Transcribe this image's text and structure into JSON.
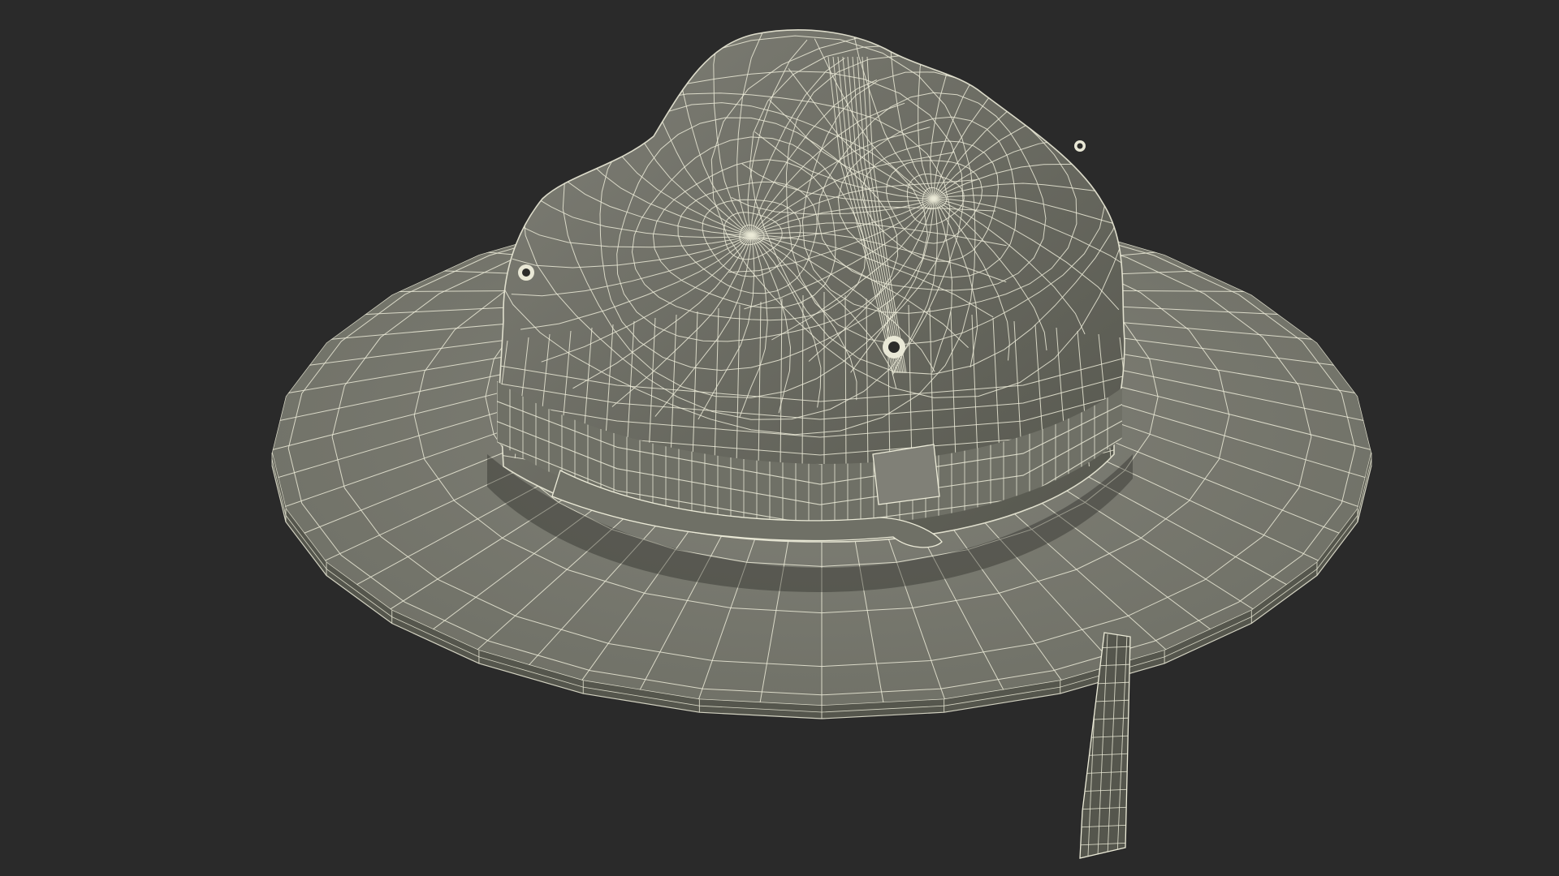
{
  "scene": {
    "subject": "campaign-hat-wireframe",
    "render_mode": "wireframe-over-shaded",
    "colors": {
      "background": "#2a2a2a",
      "surface_light": "#808077",
      "surface": "#6f7066",
      "surface_dark": "#55564d",
      "shadow": "#1d1d1b",
      "wire": "#ecebd8",
      "wire_soft": "#d8d7c4",
      "eyelet_ring": "#e9e8d6",
      "eyelet_hole": "#2c2c2a"
    }
  }
}
